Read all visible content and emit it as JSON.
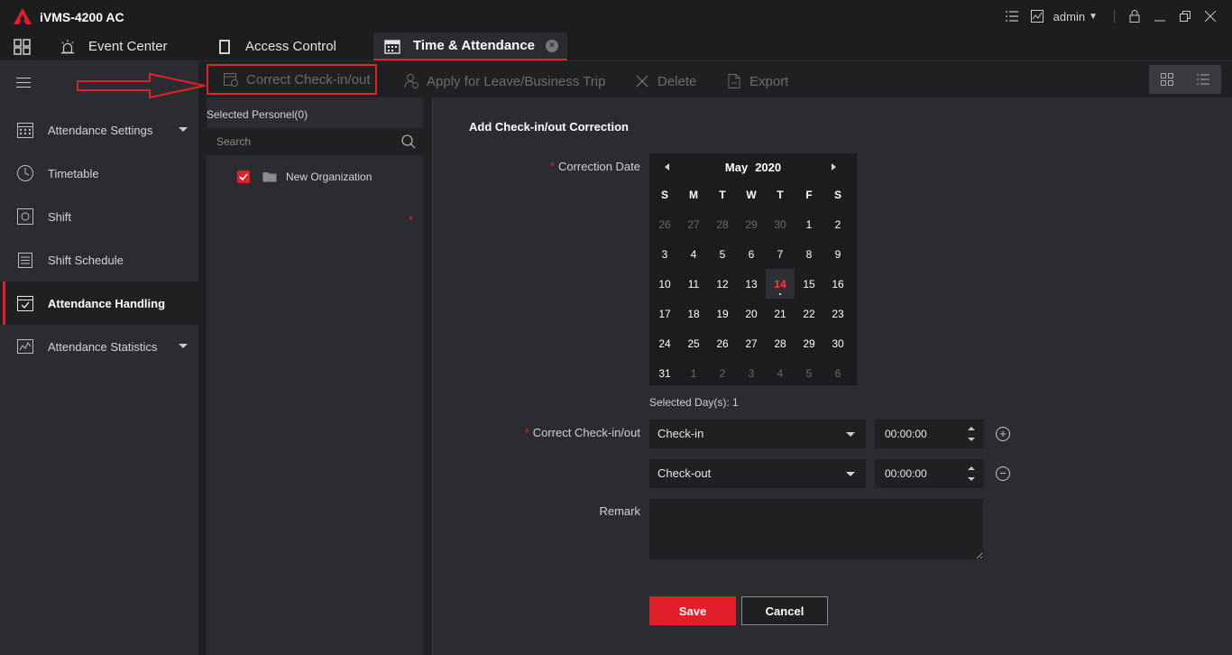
{
  "app": {
    "title": "iVMS-4200 AC",
    "user": "admin"
  },
  "tabs": [
    {
      "label": "Event Center"
    },
    {
      "label": "Access Control"
    },
    {
      "label": "Time & Attendance"
    }
  ],
  "sidebar": {
    "items": [
      {
        "label": "Attendance Settings"
      },
      {
        "label": "Timetable"
      },
      {
        "label": "Shift"
      },
      {
        "label": "Shift Schedule"
      },
      {
        "label": "Attendance Handling"
      },
      {
        "label": "Attendance Statistics"
      }
    ]
  },
  "toolbar": {
    "correct_label": "Correct Check-in/out",
    "leave_label": "Apply for Leave/Business Trip",
    "delete_label": "Delete",
    "export_label": "Export"
  },
  "person_panel": {
    "title": "Selected Personel(0)",
    "search_placeholder": "Search",
    "org_label": "New Organization"
  },
  "form": {
    "title": "Add Check-in/out Correction",
    "date_label": "Correction Date",
    "calendar": {
      "month": "May",
      "year": "2020",
      "weekdays": [
        "S",
        "M",
        "T",
        "W",
        "T",
        "F",
        "S"
      ],
      "days": [
        [
          "26",
          "27",
          "28",
          "29",
          "30",
          "1",
          "2"
        ],
        [
          "3",
          "4",
          "5",
          "6",
          "7",
          "8",
          "9"
        ],
        [
          "10",
          "11",
          "12",
          "13",
          "14",
          "15",
          "16"
        ],
        [
          "17",
          "18",
          "19",
          "20",
          "21",
          "22",
          "23"
        ],
        [
          "24",
          "25",
          "26",
          "27",
          "28",
          "29",
          "30"
        ],
        [
          "31",
          "1",
          "2",
          "3",
          "4",
          "5",
          "6"
        ]
      ],
      "today": "14"
    },
    "selected_days": "Selected Day(s): 1",
    "checkinout_label": "Correct Check-in/out",
    "row1": {
      "type": "Check-in",
      "time": "00:00:00"
    },
    "row2": {
      "type": "Check-out",
      "time": "00:00:00"
    },
    "remark_label": "Remark",
    "remark_value": "",
    "save_label": "Save",
    "cancel_label": "Cancel"
  },
  "colors": {
    "accent": "#e2202a",
    "background": "#2b2c2f"
  }
}
